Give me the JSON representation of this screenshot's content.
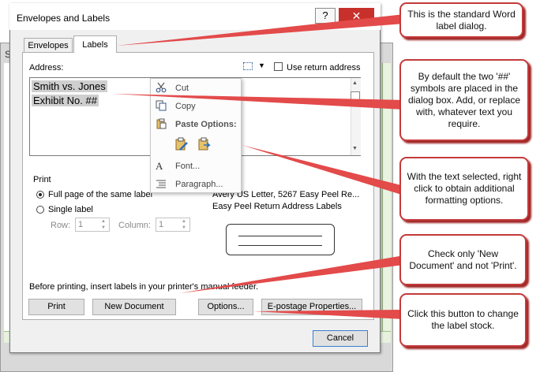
{
  "background": {
    "left_letter": "S"
  },
  "dialog": {
    "title": "Envelopes and Labels",
    "help": "?",
    "close": "✕",
    "tabs": [
      {
        "label": "Envelopes"
      },
      {
        "label": "Labels"
      }
    ],
    "address_label": "Address:",
    "addr_dropdown_arrow": "▼",
    "use_return_address": "Use return address",
    "address_lines": [
      "Smith vs. Jones",
      "Exhibit No. ##"
    ],
    "scroll_up": "▲",
    "scroll_down": "▼",
    "context_menu": {
      "cut": "Cut",
      "copy": "Copy",
      "paste_options": "Paste Options:",
      "font": "Font...",
      "paragraph": "Paragraph..."
    },
    "print": {
      "heading": "Print",
      "full_page": "Full page of the same label",
      "single_label": "Single label",
      "row_label": "Row:",
      "row_value": "1",
      "column_label": "Column:",
      "column_value": "1",
      "mode": "full_page"
    },
    "label": {
      "name": "Avery US Letter, 5267 Easy Peel Re...",
      "type": "Easy Peel Return Address Labels"
    },
    "before_printing": "Before printing, insert labels in your printer's manual feeder.",
    "buttons": {
      "print": "Print",
      "new_document": "New Document",
      "options": "Options...",
      "epostage": "E-postage Properties...",
      "cancel": "Cancel"
    }
  },
  "callouts": [
    {
      "text": "This is the standard Word label dialog."
    },
    {
      "text": "By default the two '##' symbols are placed in the dialog box. Add, or replace with, whatever text you require."
    },
    {
      "text": "With the text selected, right click to obtain additional formatting options."
    },
    {
      "text": "Check only 'New Document' and not 'Print'."
    },
    {
      "text": "Click this button to change the label stock."
    }
  ],
  "colors": {
    "callout_border": "#c43a3a",
    "close_button": "#c7302b",
    "selection": "#cfcfcf"
  }
}
